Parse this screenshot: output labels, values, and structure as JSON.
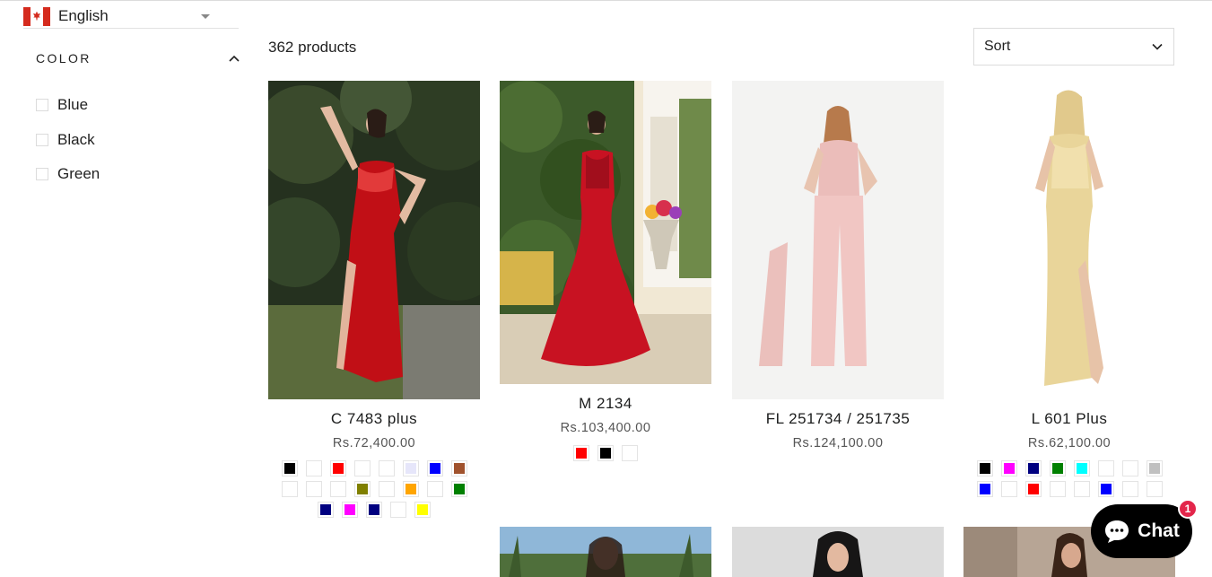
{
  "language": {
    "label": "English",
    "flag": "canada-flag-icon"
  },
  "filter": {
    "title": "COLOR",
    "options": [
      "Blue",
      "Black",
      "Green"
    ]
  },
  "results": {
    "count_label": "362 products"
  },
  "sort": {
    "label": "Sort"
  },
  "products": [
    {
      "name": "C 7483 plus",
      "price": "Rs.72,400.00",
      "image": "red-satin-gown-photo",
      "swatches": [
        "#000000",
        "#ffffff",
        "#ff0000",
        "#ffffff",
        "#ffffff",
        "#e6e6fa",
        "#0000ff",
        "#a0522d",
        "#ffffff",
        "#ffffff",
        "#ffffff",
        "#808000",
        "#ffffff",
        "#ffa500",
        "#ffffff",
        "#008000",
        "#000080",
        "#ff00ff",
        "#000080",
        "#ffffff",
        "#ffff00"
      ]
    },
    {
      "name": "M 2134",
      "price": "Rs.103,400.00",
      "image": "red-mermaid-gown-photo",
      "swatches": [
        "#ff0000",
        "#000000",
        "#ffffff"
      ]
    },
    {
      "name": "FL 251734 / 251735",
      "price": "Rs.124,100.00",
      "image": "pink-jumpsuit-photo",
      "swatches": []
    },
    {
      "name": "L 601 Plus",
      "price": "Rs.62,100.00",
      "image": "gold-satin-gown-photo",
      "swatches": [
        "#000000",
        "#ff00ff",
        "#000080",
        "#008000",
        "#00ffff",
        "#ffffff",
        "#ffffff",
        "#c0c0c0",
        "#0000ff",
        "#ffffff",
        "#ff0000",
        "#ffffff",
        "#ffffff",
        "#0000ff",
        "#ffffff",
        "#ffffff"
      ]
    },
    {
      "name": "",
      "price": "",
      "image": "outdoor-palm-photo",
      "swatches": []
    },
    {
      "name": "",
      "price": "",
      "image": "black-dress-photo",
      "swatches": []
    },
    {
      "name": "",
      "price": "",
      "image": "dress-interior-photo",
      "swatches": []
    }
  ],
  "chat": {
    "label": "Chat",
    "badge": "1"
  }
}
